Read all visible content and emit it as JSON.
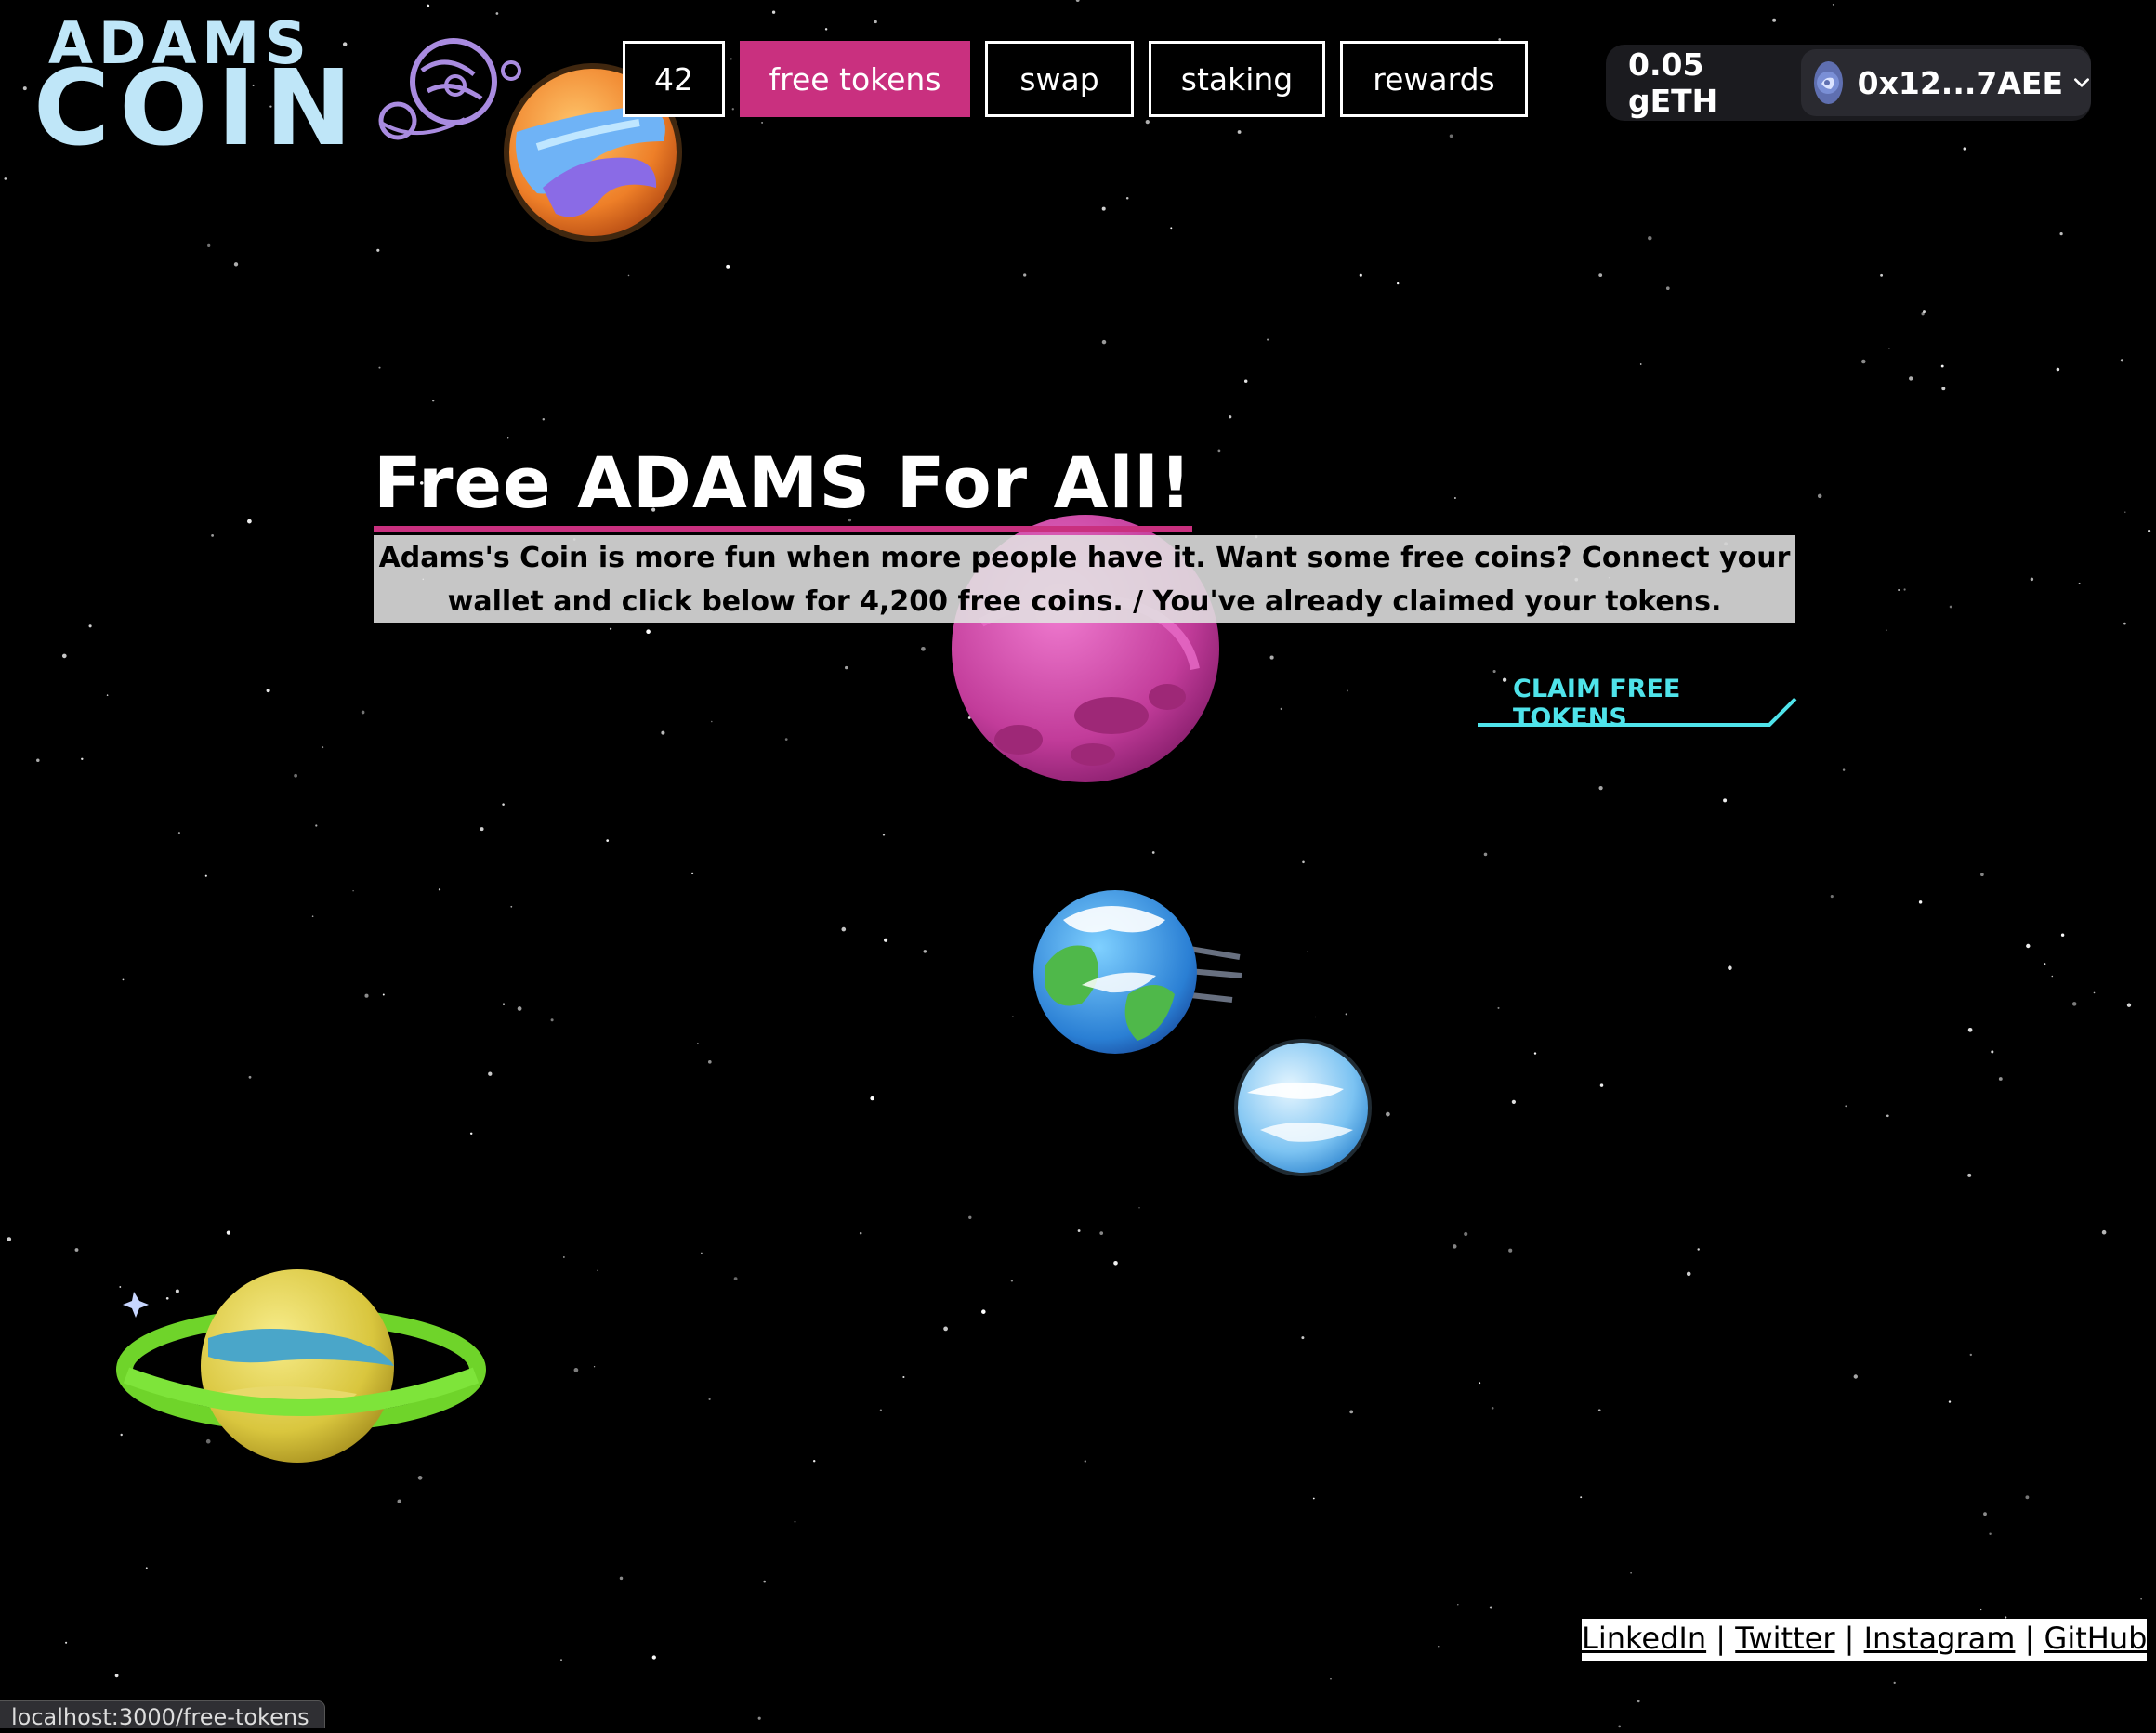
{
  "logo": {
    "line1": "ADAMS",
    "line2": "COIN"
  },
  "nav": {
    "items": [
      {
        "label": "42",
        "active": false
      },
      {
        "label": "free tokens",
        "active": true
      },
      {
        "label": "swap",
        "active": false
      },
      {
        "label": "staking",
        "active": false
      },
      {
        "label": "rewards",
        "active": false
      }
    ]
  },
  "wallet": {
    "balance": "0.05 gETH",
    "address": "0x12...7AEE"
  },
  "main": {
    "title": "Free ADAMS For All!",
    "description": "Adams's Coin is more fun when more people have it. Want some free coins? Connect your wallet and click below for 4,200 free coins. / You've already claimed your tokens.",
    "claim_button": "CLAIM FREE TOKENS"
  },
  "footer": {
    "links": [
      "LinkedIn",
      "Twitter",
      "Instagram",
      "GitHub"
    ],
    "separator": "|"
  },
  "status_bar": {
    "url": "localhost:3000/free-tokens"
  },
  "colors": {
    "accent_pink": "#c9307f",
    "claim_cyan": "#4fe3ea",
    "logo_blue": "#bfe6f8",
    "background": "#000000"
  },
  "icons": [
    "planet-logo-icon",
    "wallet-avatar-icon",
    "chevron-down-icon"
  ]
}
